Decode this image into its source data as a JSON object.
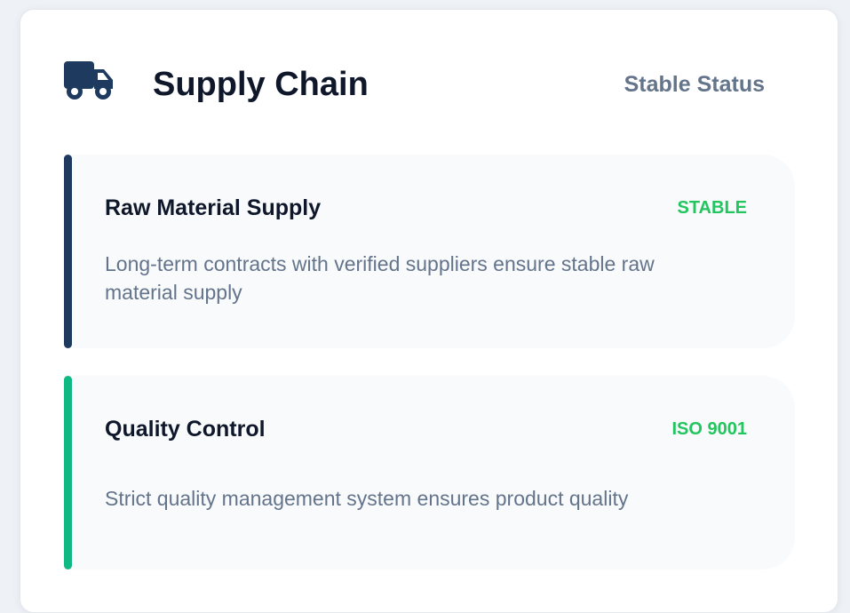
{
  "header": {
    "icon": "truck-icon",
    "title": "Supply Chain",
    "status": "Stable Status"
  },
  "items": [
    {
      "title": "Raw Material Supply",
      "badge": "STABLE",
      "description": "Long-term contracts with verified suppliers ensure stable raw material supply",
      "accent": "#1e3a5f"
    },
    {
      "title": "Quality Control",
      "badge": "ISO 9001",
      "description": "Strict quality management system ensures product quality",
      "accent": "#10b981"
    }
  ],
  "colors": {
    "brand": "#1e3a5f",
    "success": "#22c55e",
    "muted": "#64748b"
  }
}
